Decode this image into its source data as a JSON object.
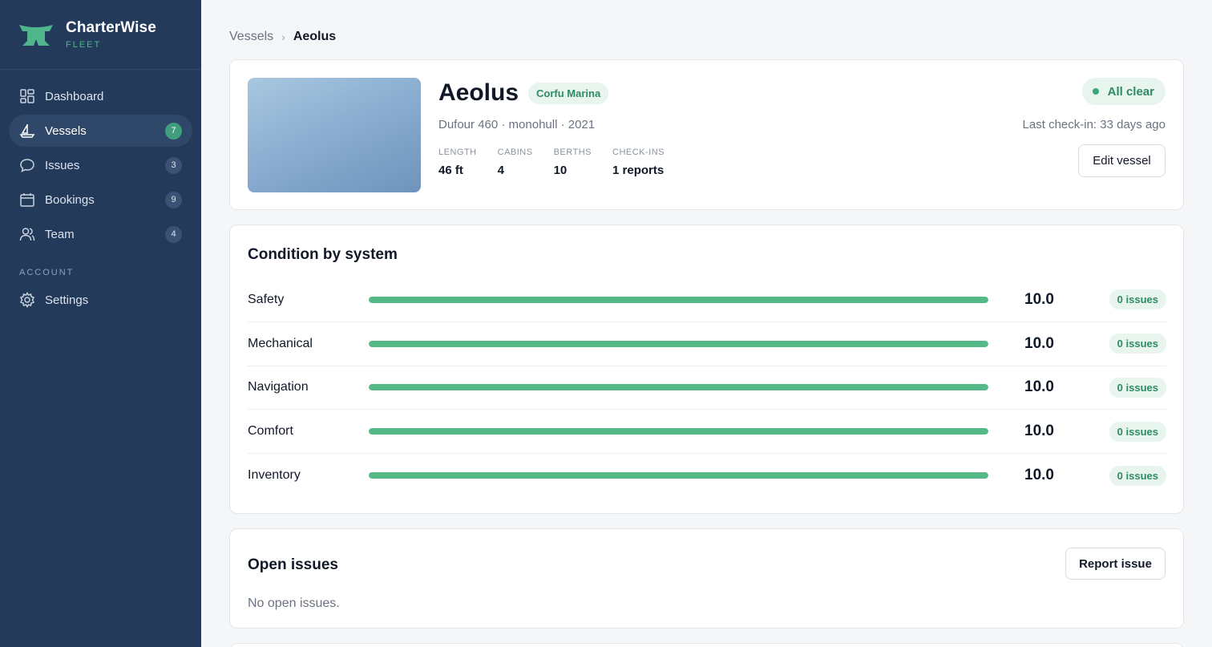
{
  "brand": {
    "name": "CharterWise",
    "sub": "FLEET"
  },
  "sidebar": {
    "items": [
      {
        "label": "Dashboard",
        "badge": "",
        "icon": "dashboard-icon"
      },
      {
        "label": "Vessels",
        "badge": "7",
        "icon": "sailboat-icon",
        "active": true
      },
      {
        "label": "Issues",
        "badge": "3",
        "icon": "chat-bubble-icon"
      },
      {
        "label": "Bookings",
        "badge": "9",
        "icon": "calendar-icon"
      },
      {
        "label": "Team",
        "badge": "4",
        "icon": "team-icon"
      }
    ],
    "section_label": "ACCOUNT",
    "settings_label": "Settings"
  },
  "breadcrumb": {
    "parent": "Vessels",
    "separator": "›",
    "current": "Aeolus"
  },
  "vessel": {
    "name": "Aeolus",
    "marina": "Corfu Marina",
    "subtitle": "Dufour 460 · monohull · 2021",
    "specs": [
      {
        "label": "LENGTH",
        "value": "46 ft"
      },
      {
        "label": "CABINS",
        "value": "4"
      },
      {
        "label": "BERTHS",
        "value": "10"
      },
      {
        "label": "CHECK-INS",
        "value": "1 reports"
      }
    ],
    "status": "All clear",
    "last_checkin": "Last check-in: 33 days ago",
    "edit_label": "Edit vessel"
  },
  "condition": {
    "title": "Condition by system",
    "rows": [
      {
        "label": "Safety",
        "score": "10.0",
        "fill": 1.0,
        "issues": "0 issues"
      },
      {
        "label": "Mechanical",
        "score": "10.0",
        "fill": 1.0,
        "issues": "0 issues"
      },
      {
        "label": "Navigation",
        "score": "10.0",
        "fill": 1.0,
        "issues": "0 issues"
      },
      {
        "label": "Comfort",
        "score": "10.0",
        "fill": 1.0,
        "issues": "0 issues"
      },
      {
        "label": "Inventory",
        "score": "10.0",
        "fill": 1.0,
        "issues": "0 issues"
      }
    ]
  },
  "issues": {
    "title": "Open issues",
    "report_label": "Report issue",
    "empty_text": "No open issues."
  },
  "colors": {
    "sidebar": "#233a5b",
    "accent": "#3f9e7c",
    "bar": "#55b987"
  }
}
